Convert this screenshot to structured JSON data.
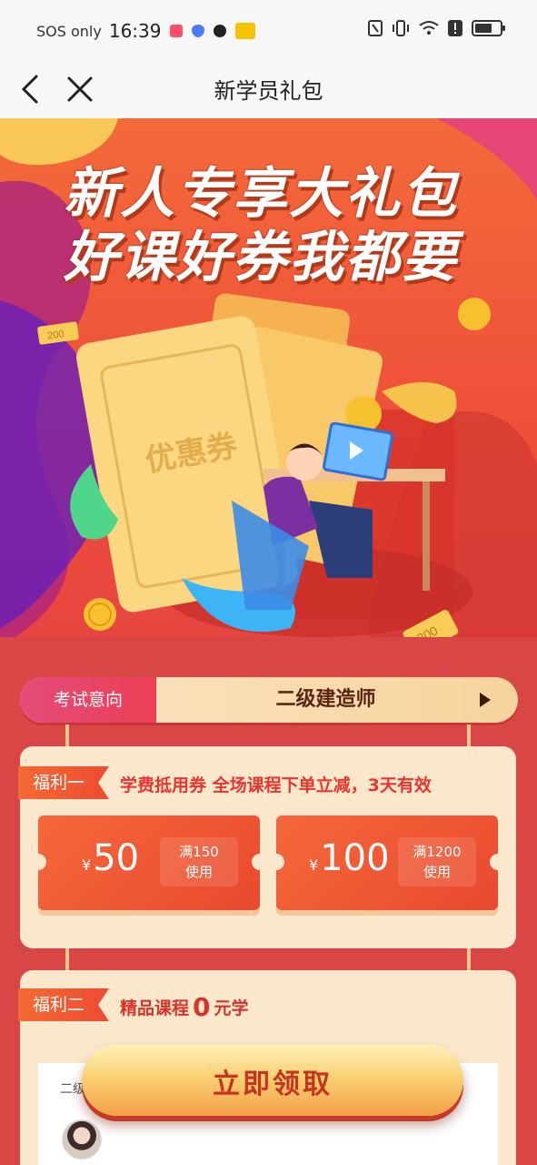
{
  "status_bar": {
    "carrier": "SOS only",
    "time": "16:39",
    "colors": {
      "app1": "#ff4d6a",
      "app2": "#4a7cf7",
      "app3": "#222222",
      "app4": "#f5c400"
    },
    "icons": [
      "nfc-icon",
      "vibrate-icon",
      "wifi-icon",
      "alert-icon",
      "battery-icon"
    ]
  },
  "nav": {
    "title": "新学员礼包",
    "back_icon": "chevron-left-icon",
    "close_icon": "close-icon"
  },
  "banner": {
    "title_line1": "新人专享大礼包",
    "title_line2": "好课好券我都要",
    "coupon_ticket_text": "优惠券",
    "ticket_values": [
      "200",
      "200"
    ]
  },
  "selector": {
    "label": "考试意向",
    "value": "二级建造师"
  },
  "benefit1": {
    "tag": "福利一",
    "description": "学费抵用券 全场课程下单立减，3天有效",
    "coupons": [
      {
        "currency": "¥",
        "amount": "50",
        "cond_line1": "满150",
        "cond_line2": "使用"
      },
      {
        "currency": "¥",
        "amount": "100",
        "cond_line1": "满1200",
        "cond_line2": "使用"
      }
    ]
  },
  "benefit2": {
    "tag": "福利二",
    "prefix": "精品课程",
    "zero": "0",
    "suffix": "元学",
    "course_visible_text": "二级"
  },
  "cta": {
    "label": "立即领取"
  },
  "colors": {
    "primary_red": "#d94646",
    "accent_orange": "#ec4c31",
    "cream": "#fbe7cc"
  }
}
